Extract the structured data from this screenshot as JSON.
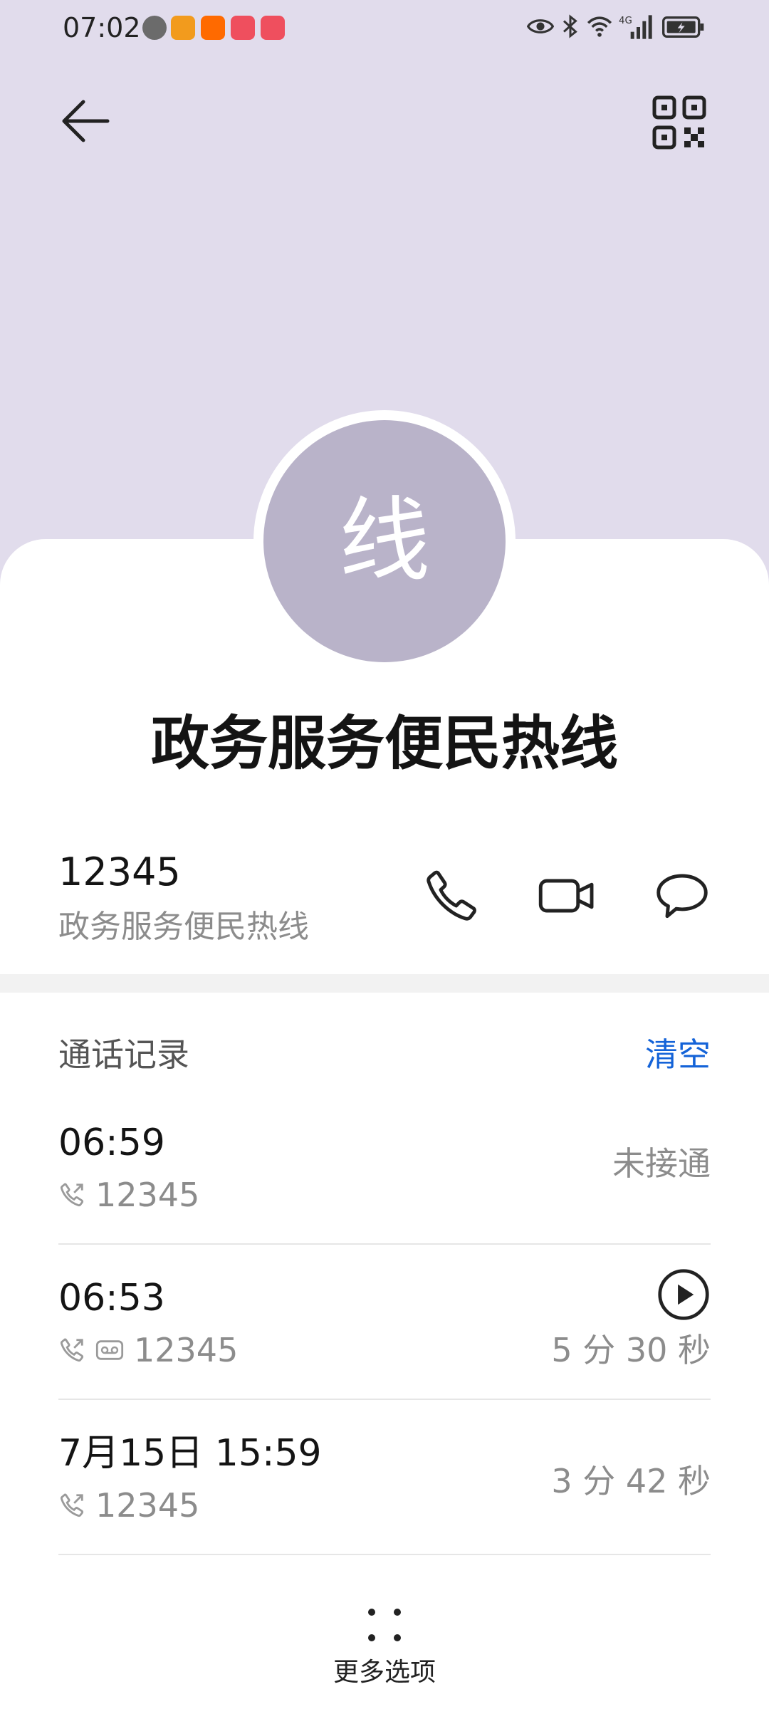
{
  "status_bar": {
    "time": "07:02"
  },
  "contact": {
    "avatar_letter": "线",
    "name": "政务服务便民热线",
    "number": "12345",
    "number_label": "政务服务便民热线"
  },
  "call_log": {
    "title": "通话记录",
    "clear_label": "清空",
    "entries": [
      {
        "time": "06:59",
        "number": "12345",
        "status": "未接通",
        "duration": ""
      },
      {
        "time": "06:53",
        "number": "12345",
        "status": "",
        "duration": "5 分 30 秒"
      },
      {
        "time": "7月15日 15:59",
        "number": "12345",
        "status": "",
        "duration": "3 分 42 秒"
      }
    ]
  },
  "footer": {
    "more_label": "更多选项"
  },
  "colors": {
    "header_bg": "#e1dcec",
    "avatar_bg": "#b9b3c9",
    "accent": "#1463d8"
  },
  "icons": {
    "back": "arrow-left-icon",
    "qr": "qr-code-icon",
    "call": "phone-icon",
    "video": "video-camera-icon",
    "message": "chat-bubble-icon",
    "play": "play-circle-icon",
    "more": "four-dots-icon"
  }
}
